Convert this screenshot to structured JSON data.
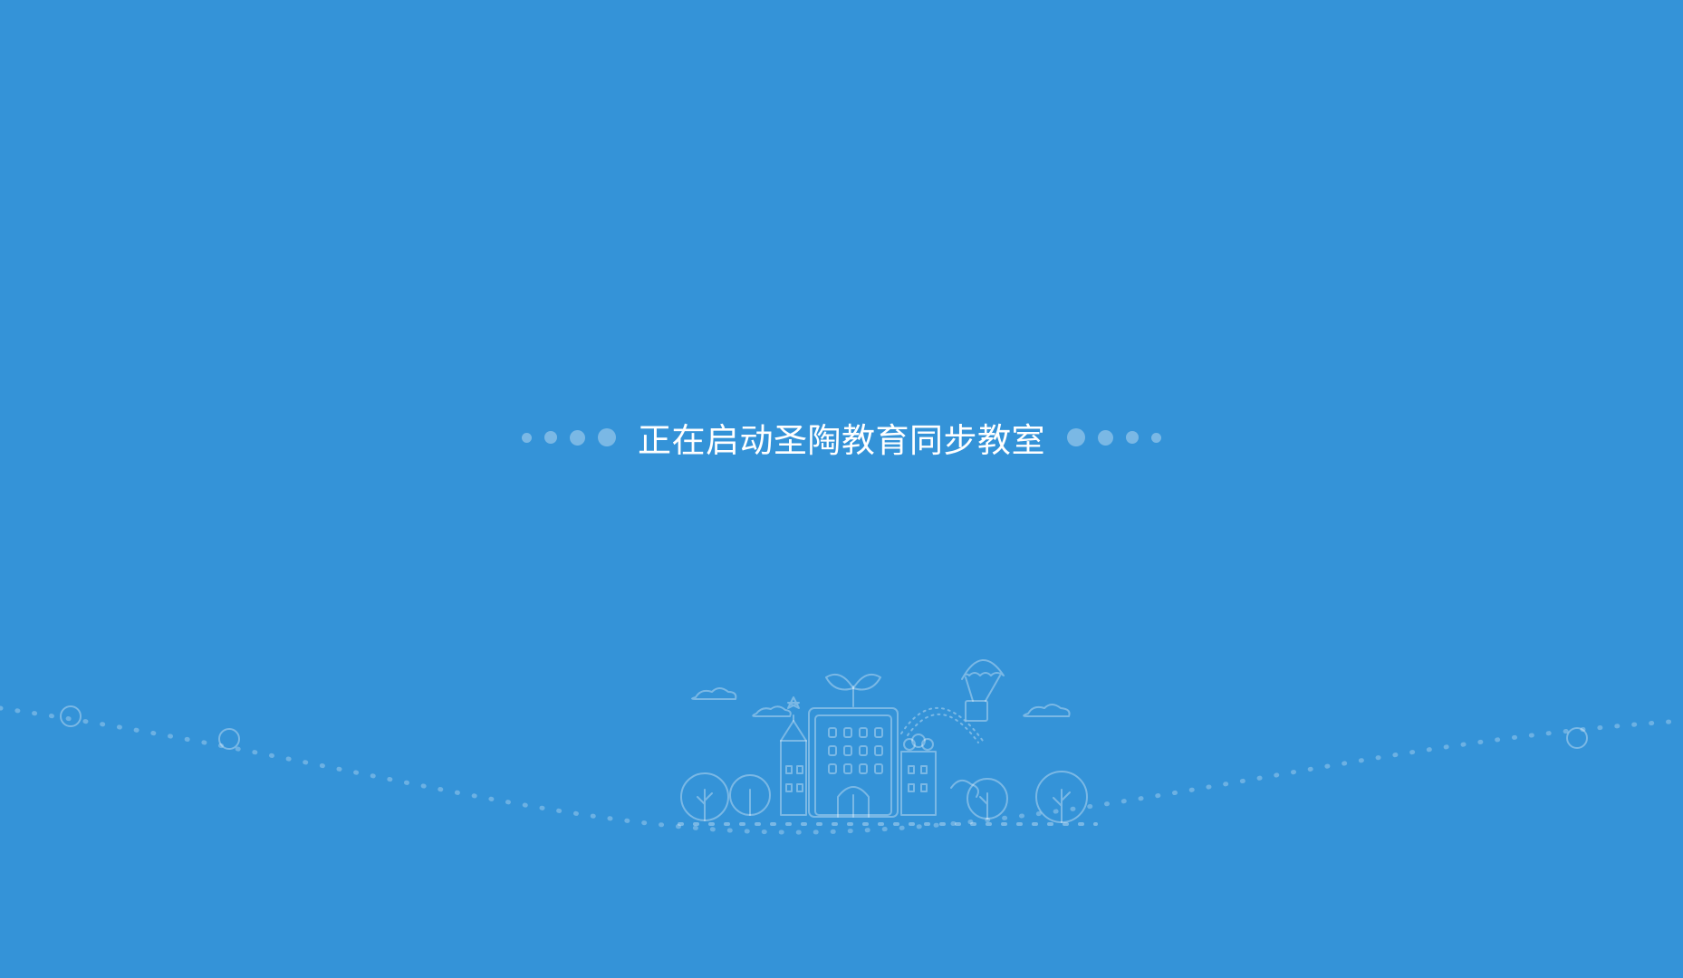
{
  "splash": {
    "status_text": "正在启动圣陶教育同步教室"
  },
  "colors": {
    "background": "#3493d8",
    "foreground": "#ffffff"
  },
  "icons": {
    "decoration": "school-building-illustration",
    "loading": "loading-dots-icon"
  }
}
